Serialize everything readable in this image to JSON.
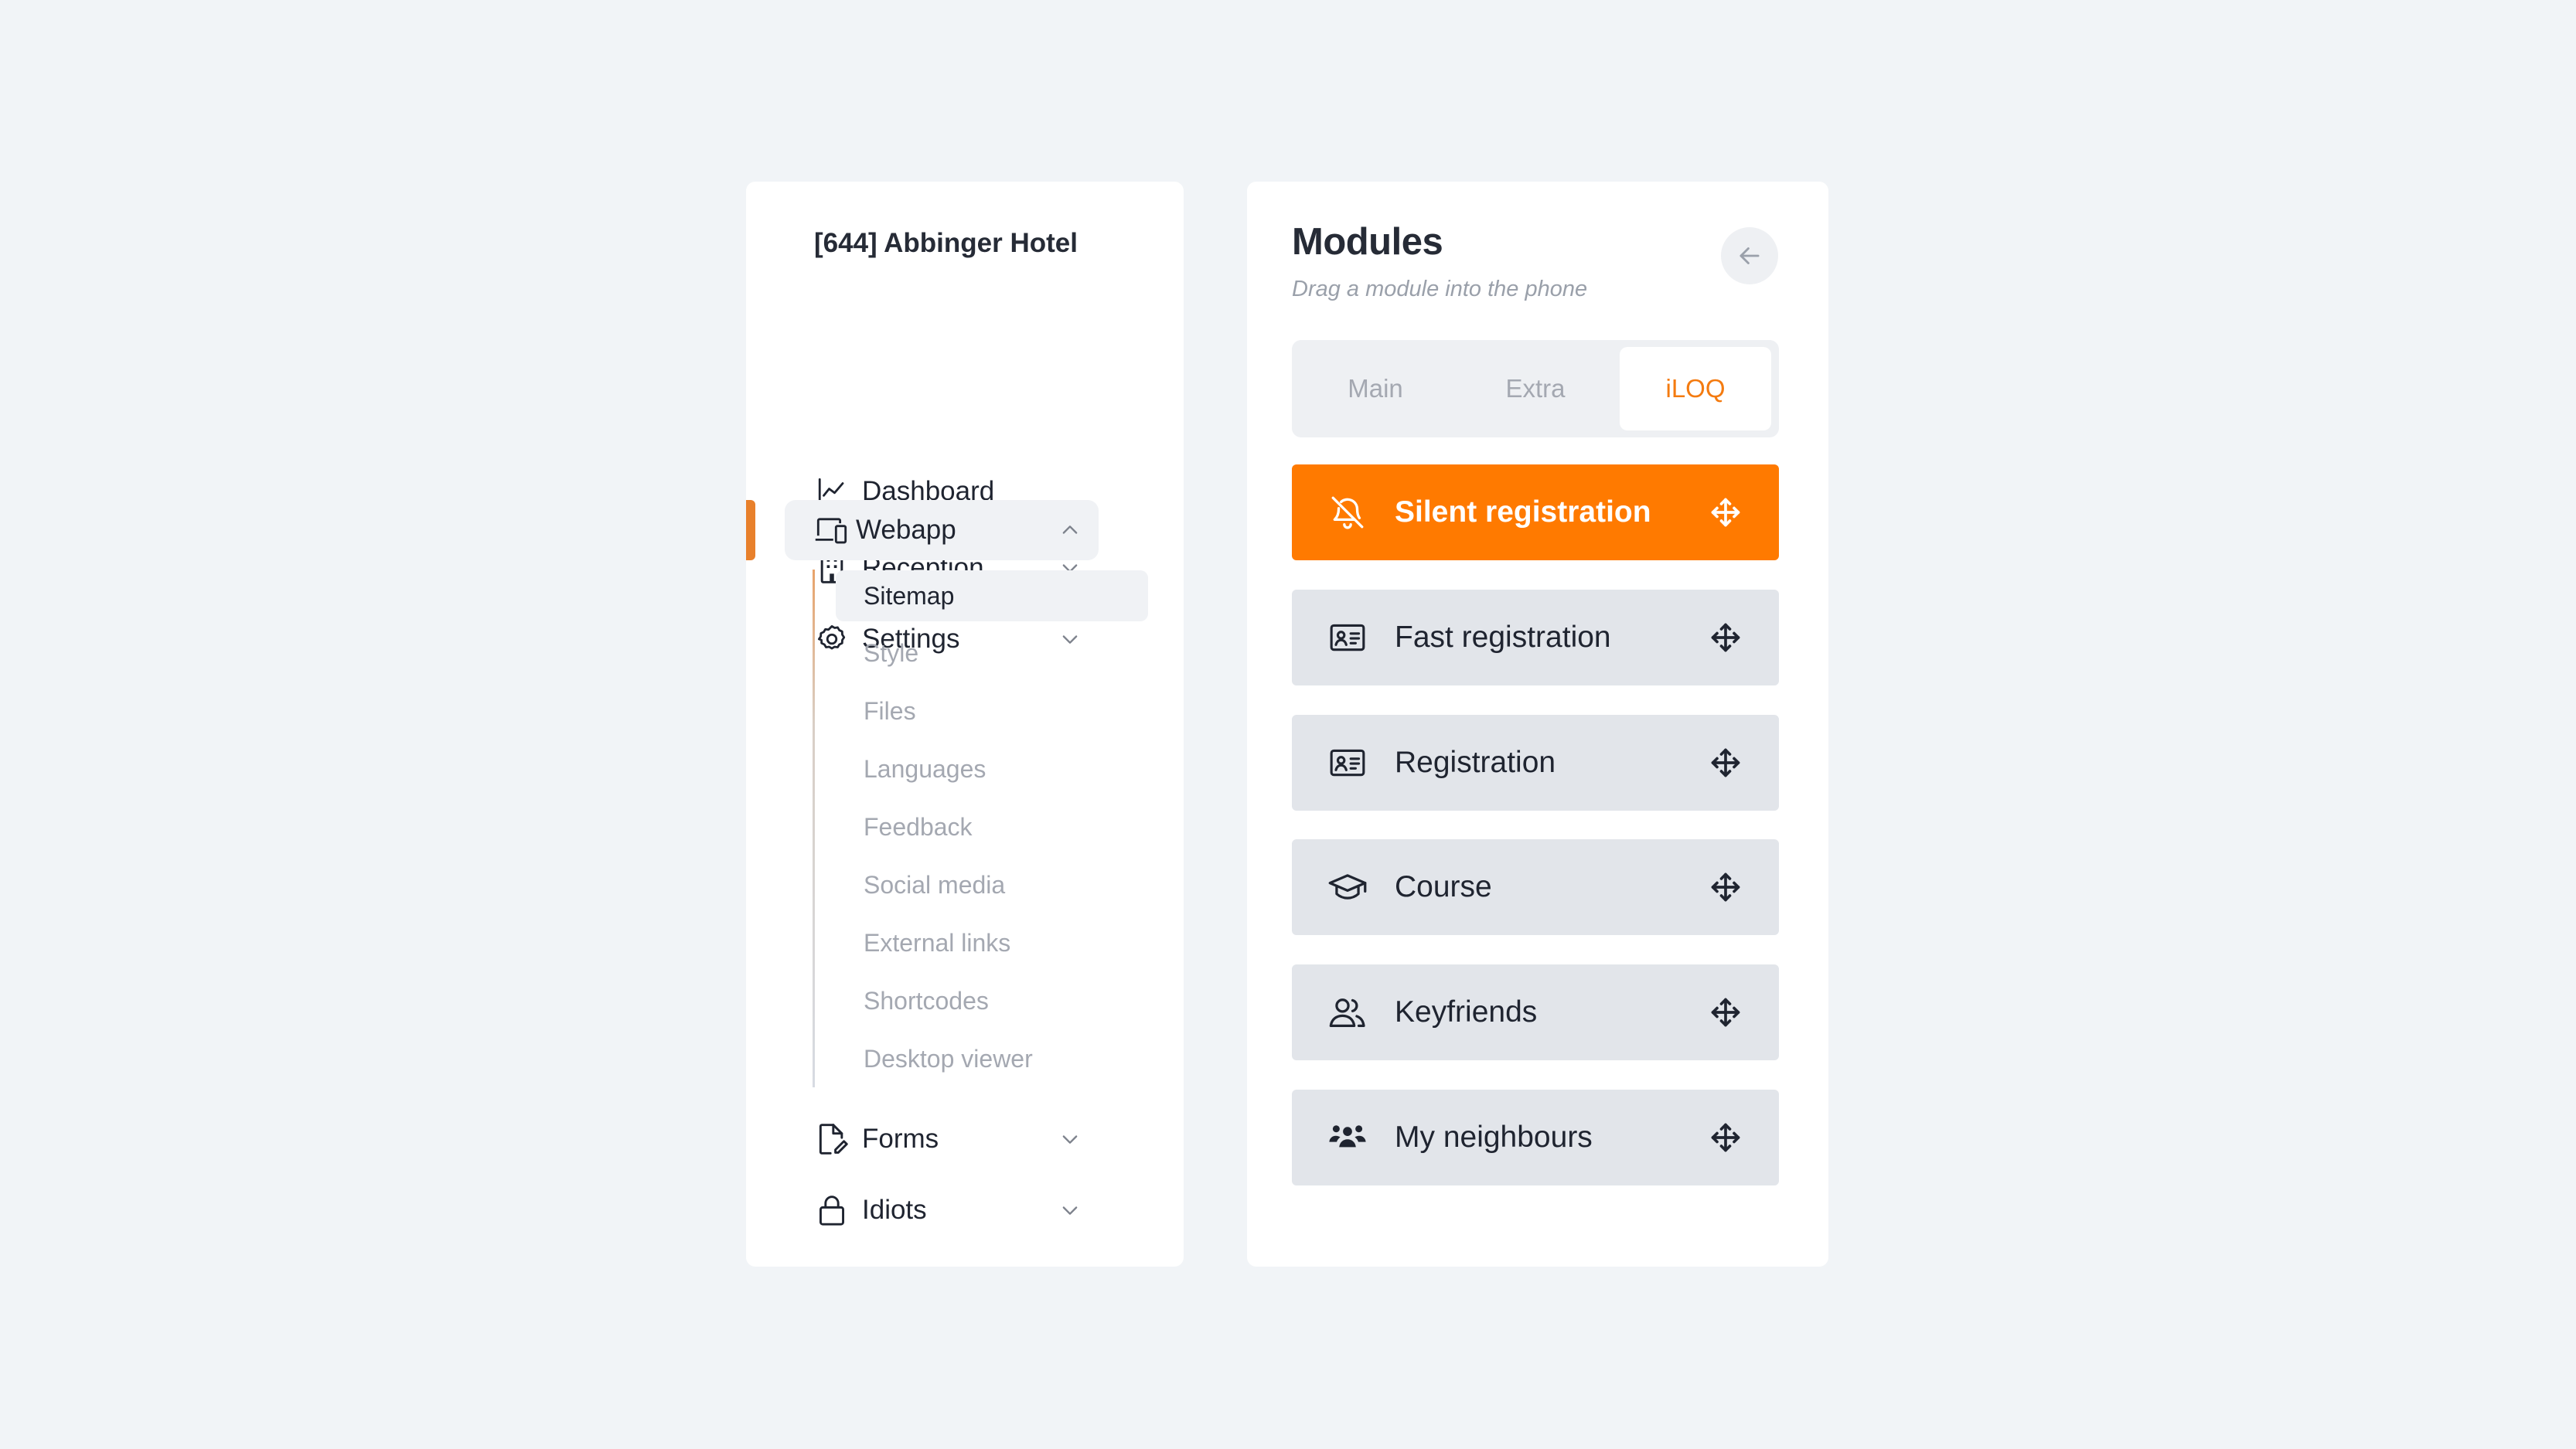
{
  "sidebar": {
    "hotel_title": "[644] Abbinger Hotel",
    "items": [
      {
        "label": "Dashboard",
        "icon": "chart-line-icon",
        "has_chevron": false
      },
      {
        "label": "Reception",
        "icon": "building-icon",
        "has_chevron": true,
        "chevron": "chevron-down-icon"
      },
      {
        "label": "Settings",
        "icon": "gear-icon",
        "has_chevron": true,
        "chevron": "chevron-down-icon"
      },
      {
        "label": "Webapp",
        "icon": "devices-icon",
        "has_chevron": true,
        "chevron": "chevron-up-icon",
        "active": true
      },
      {
        "label": "Forms",
        "icon": "file-edit-icon",
        "has_chevron": true,
        "chevron": "chevron-down-icon"
      },
      {
        "label": "Idiots",
        "icon": "lock-icon",
        "has_chevron": true,
        "chevron": "chevron-down-icon"
      }
    ],
    "webapp_subitems": [
      {
        "label": "Sitemap",
        "selected": true
      },
      {
        "label": "Style"
      },
      {
        "label": "Files"
      },
      {
        "label": "Languages"
      },
      {
        "label": "Feedback"
      },
      {
        "label": "Social media"
      },
      {
        "label": "External links"
      },
      {
        "label": "Shortcodes"
      },
      {
        "label": "Desktop viewer"
      }
    ]
  },
  "modules": {
    "title": "Modules",
    "subtitle": "Drag a module into the phone",
    "back_icon": "arrow-left-icon",
    "tabs": [
      {
        "label": "Main"
      },
      {
        "label": "Extra"
      },
      {
        "label": "iLOQ",
        "active": true
      }
    ],
    "items": [
      {
        "label": "Silent registration",
        "icon": "bell-off-icon",
        "highlight": true
      },
      {
        "label": "Fast registration",
        "icon": "id-card-icon"
      },
      {
        "label": "Registration",
        "icon": "id-card-icon"
      },
      {
        "label": "Course",
        "icon": "graduation-cap-icon"
      },
      {
        "label": "Keyfriends",
        "icon": "users-icon"
      },
      {
        "label": "My neighbours",
        "icon": "group-icon"
      }
    ],
    "drag_icon": "move-arrows-icon"
  },
  "colors": {
    "background": "#f1f4f7",
    "accent": "#ff7a00",
    "active_indicator": "#e8802b",
    "module_bg": "#e2e5ea"
  }
}
